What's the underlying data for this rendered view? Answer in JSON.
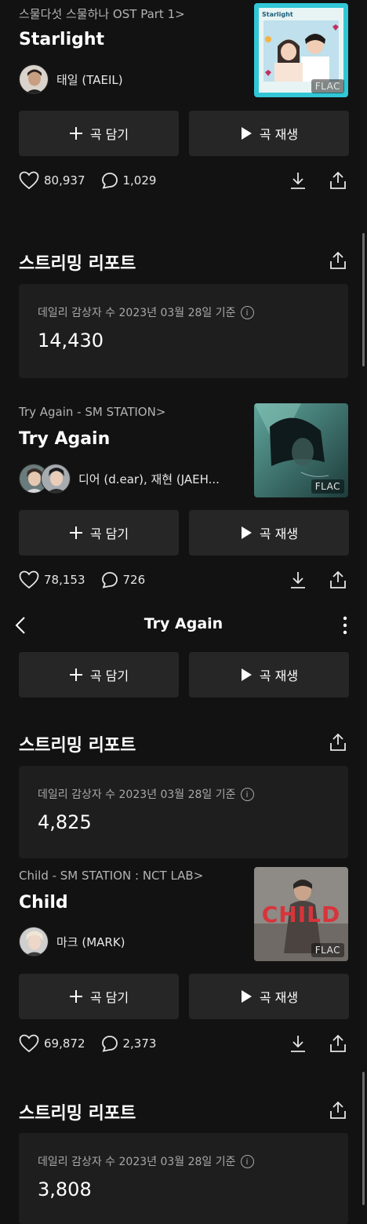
{
  "tracks": [
    {
      "album": "스물다섯 스물하나 OST Part 1",
      "title": "Starlight",
      "artist": "태일 (TAEIL)",
      "badge": "FLAC",
      "likes": "80,937",
      "comments": "1,029",
      "add_label": "곡 담기",
      "play_label": "곡 재생",
      "cover_text": "Starlight",
      "report": {
        "title": "스트리밍 리포트",
        "label": "데일리 감상자 수 2023년 03월 28일 기준",
        "value": "14,430"
      }
    },
    {
      "album": "Try Again - SM STATION",
      "title": "Try Again",
      "artist": "디어 (d.ear), 재현 (JAEH...",
      "badge": "FLAC",
      "likes": "78,153",
      "comments": "726",
      "add_label": "곡 담기",
      "play_label": "곡 재생",
      "report": {
        "title": "스트리밍 리포트",
        "label": "데일리 감상자 수 2023년 03월 28일 기준",
        "value": "4,825"
      }
    },
    {
      "album": "Child - SM STATION : NCT LAB",
      "title": "Child",
      "artist": "마크 (MARK)",
      "badge": "FLAC",
      "likes": "69,872",
      "comments": "2,373",
      "add_label": "곡 담기",
      "play_label": "곡 재생",
      "cover_text": "CHILD",
      "report": {
        "title": "스트리밍 리포트",
        "label": "데일리 감상자 수 2023년 03월 28일 기준",
        "value": "3,808"
      }
    }
  ],
  "nav": {
    "title": "Try Again"
  },
  "sticky_buttons": {
    "add_label": "곡 담기",
    "play_label": "곡 재생"
  },
  "icons": {
    "back": "chevron-left-icon",
    "more": "more-vertical-icon",
    "like": "heart-icon",
    "comment": "comment-icon",
    "download": "download-icon",
    "share": "share-icon",
    "info": "info-icon",
    "add": "plus-icon",
    "play": "play-icon"
  },
  "colors": {
    "background": "#121212",
    "card": "#1e1e1e",
    "button": "#262626",
    "muted": "#b3b3b3"
  }
}
